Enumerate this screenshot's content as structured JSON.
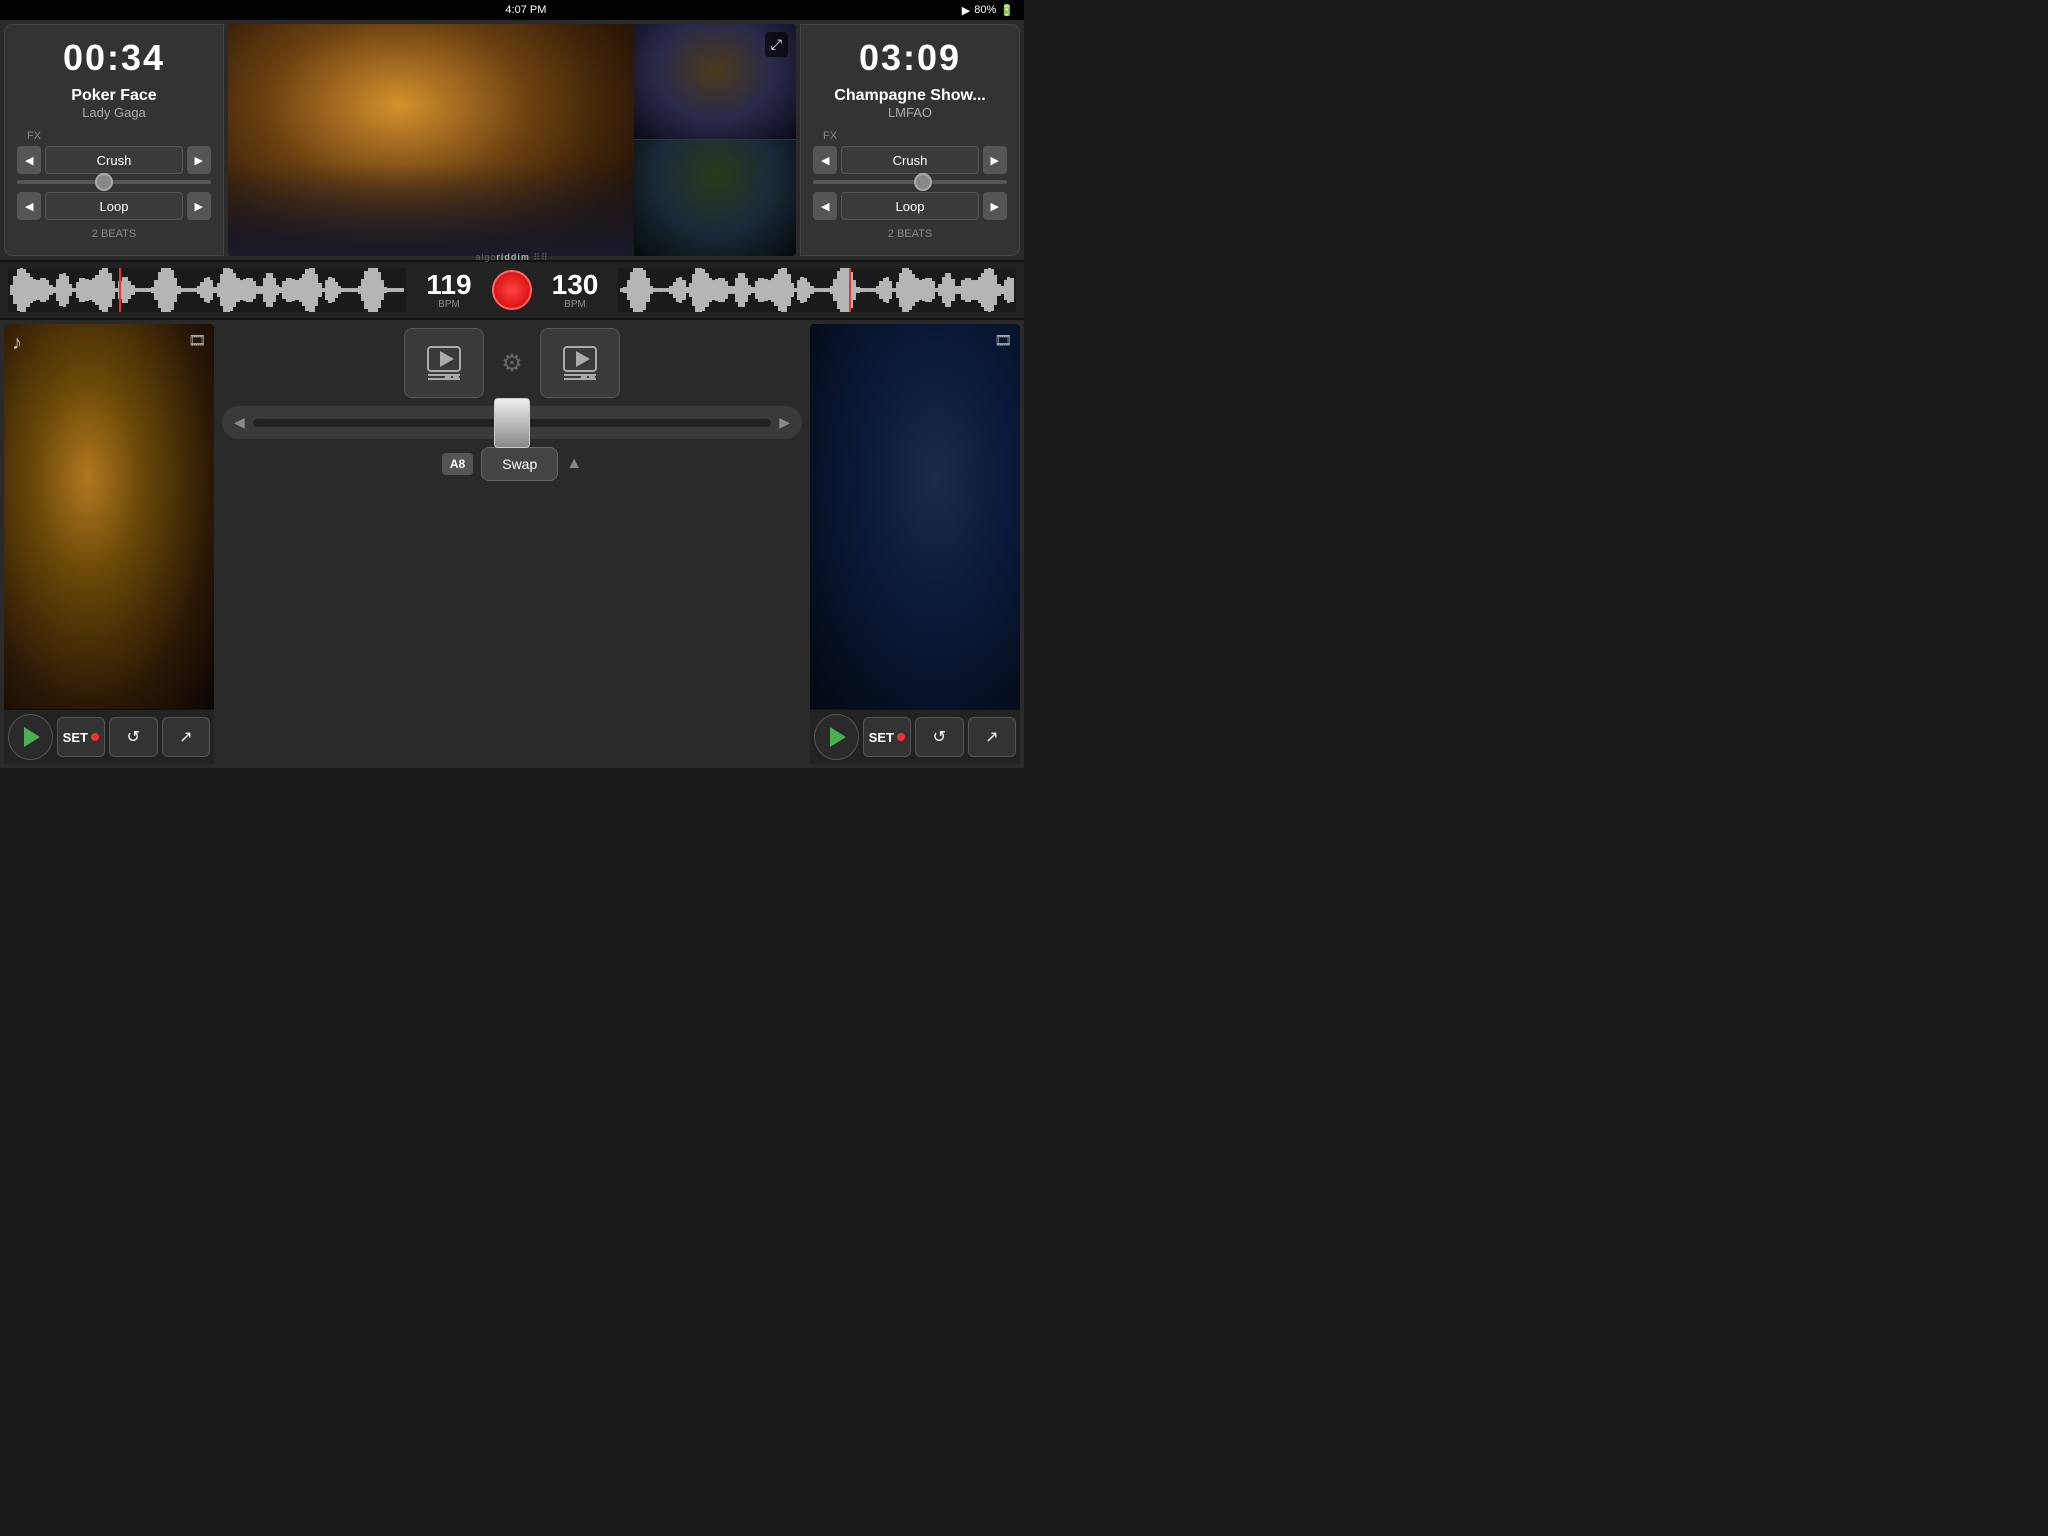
{
  "statusBar": {
    "time": "4:07 PM",
    "battery": "80%",
    "playIcon": "▶"
  },
  "leftDeck": {
    "timer": "00:34",
    "trackTitle": "Poker Face",
    "trackArtist": "Lady Gaga",
    "fx": {
      "label": "FX",
      "effectName": "Crush",
      "loopName": "Loop",
      "beats": "2 BEATS"
    },
    "bpm": "119",
    "bpmLabel": "BPM"
  },
  "rightDeck": {
    "timer": "03:09",
    "trackTitle": "Champagne Show...",
    "trackArtist": "LMFAO",
    "fx": {
      "label": "FX",
      "effectName": "Crush",
      "loopName": "Loop",
      "beats": "2 BEATS"
    },
    "bpm": "130",
    "bpmLabel": "BPM"
  },
  "center": {
    "logo": "algoriddim",
    "recordBtn": "●",
    "mediaLeftIcon": "🎬🎵",
    "mediaRightIcon": "🎬🎵",
    "gearIcon": "⚙",
    "crossfaderLeft": "◀",
    "crossfaderRight": "▶",
    "swap": {
      "badge": "A8",
      "label": "Swap",
      "arrow": "▲"
    }
  },
  "transport": {
    "playLabel": "▶",
    "setLabel": "SET",
    "undoLabel": "↺",
    "mixLabel": "↗"
  },
  "expandIcon": "⤢"
}
